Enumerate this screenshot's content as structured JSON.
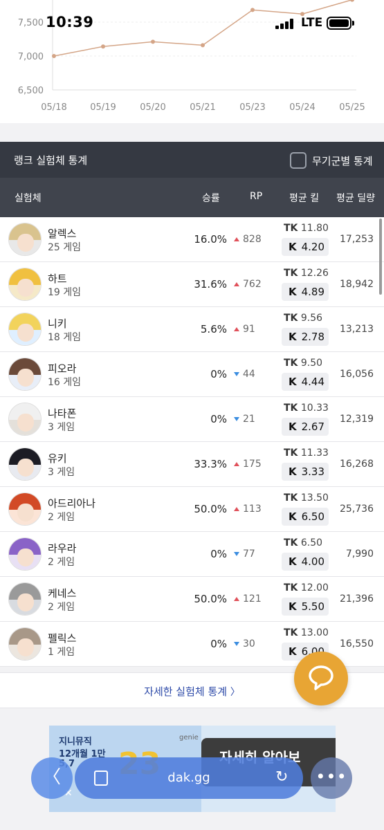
{
  "status": {
    "time": "10:39",
    "network": "LTE"
  },
  "chart_data": {
    "type": "line",
    "x": [
      "05/18",
      "05/19",
      "05/20",
      "05/21",
      "05/23",
      "05/24",
      "05/25"
    ],
    "yticks": [
      "7,500",
      "7,000",
      "6,500"
    ],
    "values": [
      7000,
      7140,
      7210,
      7160,
      7680,
      7620,
      7830
    ],
    "ylim": [
      6500,
      7500
    ],
    "color": "#d4a587"
  },
  "stats": {
    "title": "랭크 실험체 통계",
    "weapon_toggle": "무기군별 통계",
    "columns": {
      "character": "실험체",
      "winrate": "승률",
      "rp": "RP",
      "avg_kill": "평균 킬",
      "avg_damage": "평균 딜량"
    },
    "rows": [
      {
        "name": "알렉스",
        "games": "25 게임",
        "winrate": "16.0%",
        "rp_dir": "up",
        "rp": "828",
        "tk": "11.80",
        "k": "4.20",
        "damage": "17,253",
        "avatar": "alex"
      },
      {
        "name": "하트",
        "games": "19 게임",
        "winrate": "31.6%",
        "rp_dir": "up",
        "rp": "762",
        "tk": "12.26",
        "k": "4.89",
        "damage": "18,942",
        "avatar": "hart"
      },
      {
        "name": "니키",
        "games": "18 게임",
        "winrate": "5.6%",
        "rp_dir": "up",
        "rp": "91",
        "tk": "9.56",
        "k": "2.78",
        "damage": "13,213",
        "avatar": "nicky"
      },
      {
        "name": "피오라",
        "games": "16 게임",
        "winrate": "0%",
        "rp_dir": "down",
        "rp": "44",
        "tk": "9.50",
        "k": "4.44",
        "damage": "16,056",
        "avatar": "fiora"
      },
      {
        "name": "나타폰",
        "games": "3 게임",
        "winrate": "0%",
        "rp_dir": "down",
        "rp": "21",
        "tk": "10.33",
        "k": "2.67",
        "damage": "12,319",
        "avatar": "nathapon"
      },
      {
        "name": "유키",
        "games": "3 게임",
        "winrate": "33.3%",
        "rp_dir": "up",
        "rp": "175",
        "tk": "11.33",
        "k": "3.33",
        "damage": "16,268",
        "avatar": "yuki"
      },
      {
        "name": "아드리아나",
        "games": "2 게임",
        "winrate": "50.0%",
        "rp_dir": "up",
        "rp": "113",
        "tk": "13.50",
        "k": "6.50",
        "damage": "25,736",
        "avatar": "adriana"
      },
      {
        "name": "라우라",
        "games": "2 게임",
        "winrate": "0%",
        "rp_dir": "down",
        "rp": "77",
        "tk": "6.50",
        "k": "4.00",
        "damage": "7,990",
        "avatar": "laura"
      },
      {
        "name": "케네스",
        "games": "2 게임",
        "winrate": "50.0%",
        "rp_dir": "up",
        "rp": "121",
        "tk": "12.00",
        "k": "5.50",
        "damage": "21,396",
        "avatar": "kenneth"
      },
      {
        "name": "펠릭스",
        "games": "1 게임",
        "winrate": "0%",
        "rp_dir": "down",
        "rp": "30",
        "tk": "13.00",
        "k": "6.00",
        "damage": "16,550",
        "avatar": "felix"
      }
    ],
    "tk_label": "TK",
    "k_label": "K"
  },
  "detail_link": "자세한 실험체 통계",
  "ad": {
    "line1": "지니뮤직",
    "line2": "12개월 1만",
    "line3": "5,7",
    "brand": "genie",
    "big": "23",
    "cta": "자세히 알아보",
    "close": "✕"
  },
  "browser": {
    "url": "dak.gg"
  },
  "colors": {
    "rp_up": "#e0505a",
    "rp_down": "#3b8de0",
    "header_bg": "#353942",
    "fab": "#e8a534",
    "link": "#2d4aa8"
  }
}
